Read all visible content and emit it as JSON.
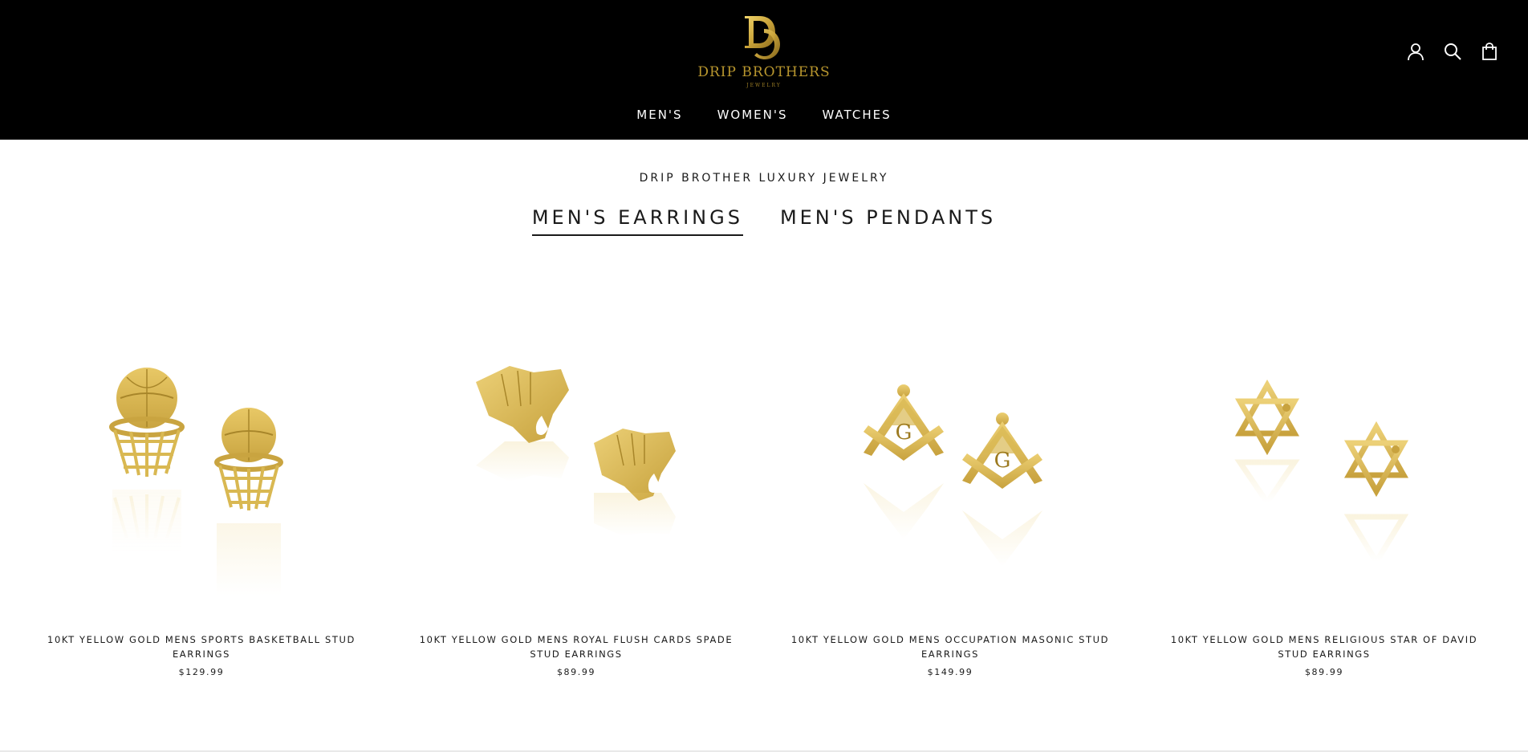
{
  "brand": {
    "name": "DRIP BROTHERS",
    "subname": "JEWELRY",
    "monogram": "DB",
    "gold": "#b8962e"
  },
  "nav": {
    "items": [
      {
        "label": "MEN'S"
      },
      {
        "label": "WOMEN'S"
      },
      {
        "label": "WATCHES"
      }
    ]
  },
  "header_icons": [
    "account-icon",
    "search-icon",
    "cart-icon"
  ],
  "collection": {
    "eyebrow": "DRIP BROTHER LUXURY JEWELRY",
    "tabs": [
      {
        "label": "MEN'S EARRINGS",
        "active": true
      },
      {
        "label": "MEN'S PENDANTS",
        "active": false
      }
    ]
  },
  "products": [
    {
      "title": "10KT YELLOW GOLD MENS SPORTS BASKETBALL STUD EARRINGS",
      "price": "$129.99",
      "image": "basketball-hoop-earrings"
    },
    {
      "title": "10KT YELLOW GOLD MENS ROYAL FLUSH CARDS SPADE STUD EARRINGS",
      "price": "$89.99",
      "image": "playing-cards-earrings"
    },
    {
      "title": "10KT YELLOW GOLD MENS OCCUPATION MASONIC STUD EARRINGS",
      "price": "$149.99",
      "image": "masonic-compass-earrings"
    },
    {
      "title": "10KT YELLOW GOLD MENS RELIGIOUS STAR OF DAVID STUD EARRINGS",
      "price": "$89.99",
      "image": "star-of-david-earrings"
    }
  ],
  "colors": {
    "header_bg": "#000000",
    "nav_text": "#ffffff",
    "gold": "#d4af37",
    "gold_dark": "#a8862a",
    "text": "#1a1a1a"
  }
}
